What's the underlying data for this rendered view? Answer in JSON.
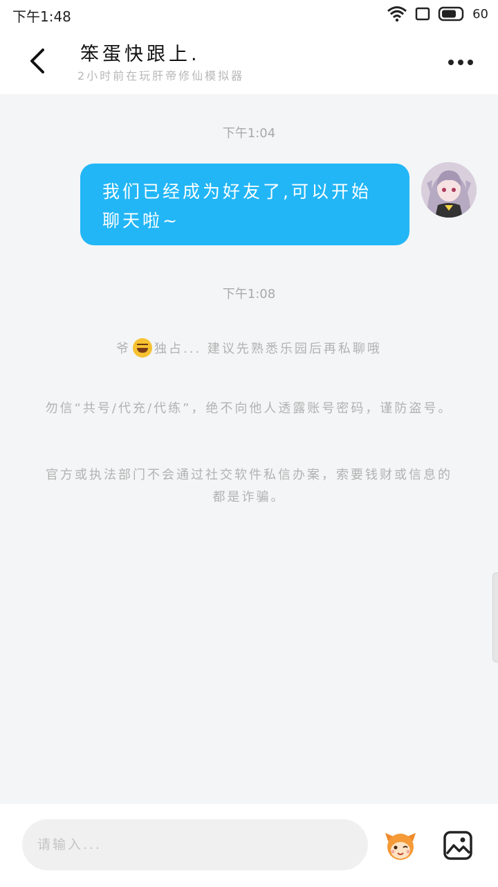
{
  "status_bar": {
    "time": "下午1:48",
    "battery": "60",
    "icons": [
      "wifi-icon",
      "screen-icon",
      "battery-icon"
    ]
  },
  "header": {
    "title": "笨蛋快跟上.",
    "subtitle": "2小时前在玩肝帝修仙模拟器",
    "back_icon": "chevron-left-icon",
    "more_icon": "more-horizontal-icon"
  },
  "chat": {
    "time_1": "下午1:04",
    "message_1": "我们已经成为好友了,可以开始聊天啦~",
    "time_2": "下午1:08",
    "system_msg_prefix": "爷",
    "system_msg_suffix": "独占... 建议先熟悉乐园后再私聊哦",
    "notice_1": "勿信“共号/代充/代练”，绝不向他人透露账号密码，谨防盗号。",
    "notice_2": "官方或执法部门不会通过社交软件私信办案，索要钱财或信息的都是诈骗。"
  },
  "input_bar": {
    "placeholder": "请输入...",
    "emoji_icon": "mascot-emoji-icon",
    "image_icon": "image-icon"
  },
  "colors": {
    "bubble": "#22b6f7",
    "chat_bg": "#f3f5f6",
    "header_bg": "#ffffff"
  }
}
